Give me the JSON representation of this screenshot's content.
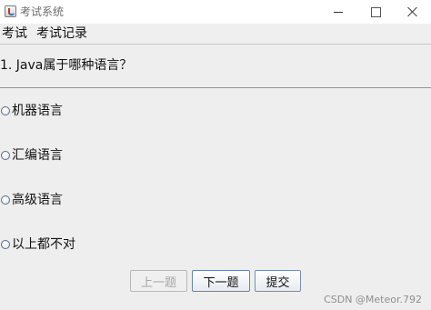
{
  "window": {
    "title": "考试系统",
    "icon": "java-cup-icon"
  },
  "menubar": {
    "items": [
      {
        "label": "考试"
      },
      {
        "label": "考试记录"
      }
    ]
  },
  "question": {
    "text": "1. Java属于哪种语言？"
  },
  "options": [
    {
      "label": "机器语言",
      "selected": false
    },
    {
      "label": "汇编语言",
      "selected": false
    },
    {
      "label": "高级语言",
      "selected": false
    },
    {
      "label": "以上都不对",
      "selected": false
    }
  ],
  "buttons": {
    "prev_label": "上一题",
    "prev_enabled": false,
    "next_label": "下一题",
    "submit_label": "提交"
  },
  "watermark": {
    "text": "CSDN @Meteor.792"
  }
}
